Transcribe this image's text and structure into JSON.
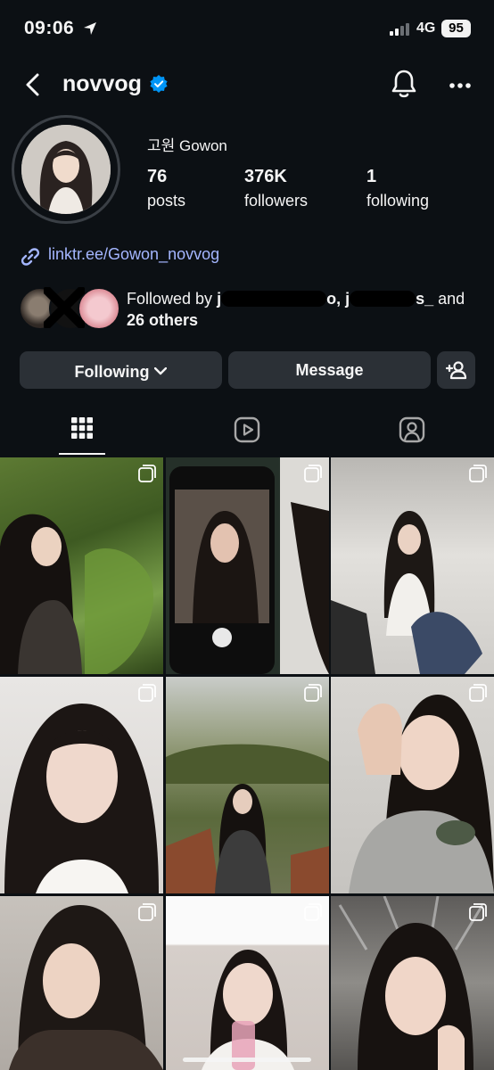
{
  "status_bar": {
    "time": "09:06",
    "network": "4G",
    "battery": "95"
  },
  "header": {
    "username": "novvog"
  },
  "profile": {
    "display_name": "고원 Gowon",
    "stats": [
      {
        "value": "76",
        "label": "posts"
      },
      {
        "value": "376K",
        "label": "followers"
      },
      {
        "value": "1",
        "label": "following"
      }
    ],
    "link": "linktr.ee/Gowon_novvog",
    "followed_by": {
      "prefix": "Followed by",
      "name1_visible": "j",
      "name1_tail": "o,",
      "name2_visible": "j",
      "name2_tail": "s_",
      "and_text": "and",
      "others": "26 others"
    }
  },
  "actions": {
    "following_label": "Following",
    "message_label": "Message"
  },
  "tabs": [
    {
      "name": "posts-grid",
      "icon": "grid-icon",
      "active": true
    },
    {
      "name": "reels",
      "icon": "reels-icon",
      "active": false
    },
    {
      "name": "tagged",
      "icon": "tagged-icon",
      "active": false
    }
  ],
  "colors": {
    "background": "#0c1014",
    "button": "#2b3036",
    "link": "#a4b6ff",
    "verified": "#0095f6"
  }
}
